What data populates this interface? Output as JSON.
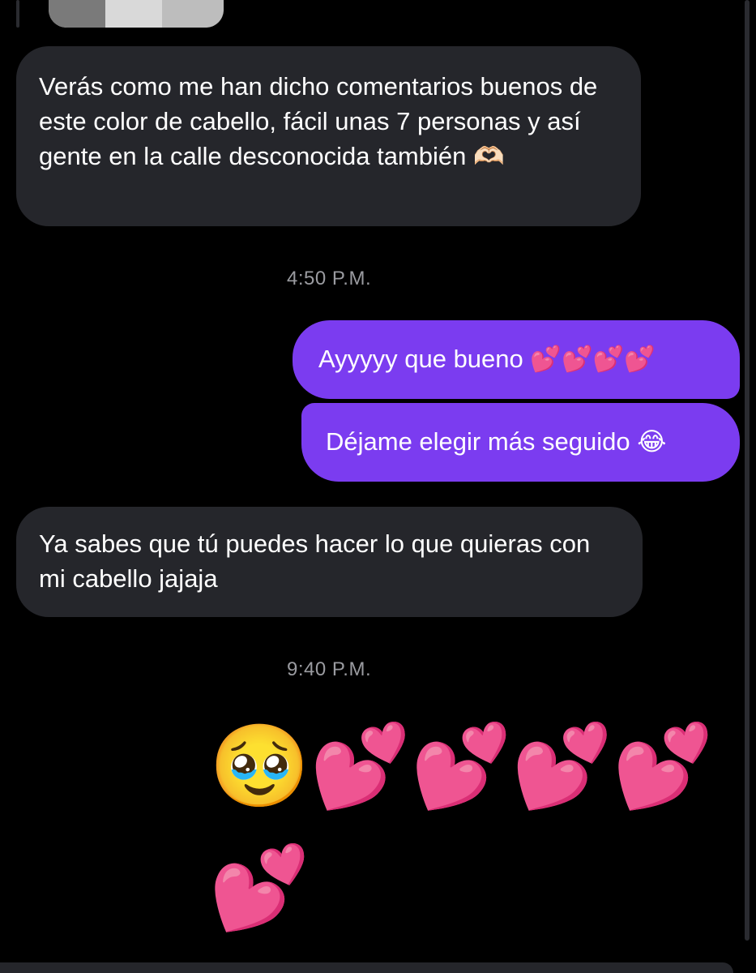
{
  "conversation": {
    "messages": [
      {
        "direction": "incoming",
        "text": "Verás como me han dicho comentarios buenos de este color de cabello, fácil unas 7 personas y así gente en la calle desconocida también 🫶🏻"
      },
      {
        "direction": "outgoing",
        "text": "Ayyyyy que bueno 💕💕💕💕"
      },
      {
        "direction": "outgoing",
        "text": "Déjame elegir más seguido 😂"
      },
      {
        "direction": "incoming",
        "text": "Ya sabes que tú puedes hacer lo que quieras con mi cabello jajaja"
      }
    ],
    "timestamps": [
      "4:50 P.M.",
      "9:40 P.M."
    ],
    "emoji_message": {
      "row1": "🥹💕💕💕💕",
      "row2": "💕"
    }
  },
  "colors": {
    "background": "#000000",
    "incoming_bubble": "#25262b",
    "outgoing_bubble": "#7b3cf0",
    "timestamp_text": "#9a9ba0"
  }
}
